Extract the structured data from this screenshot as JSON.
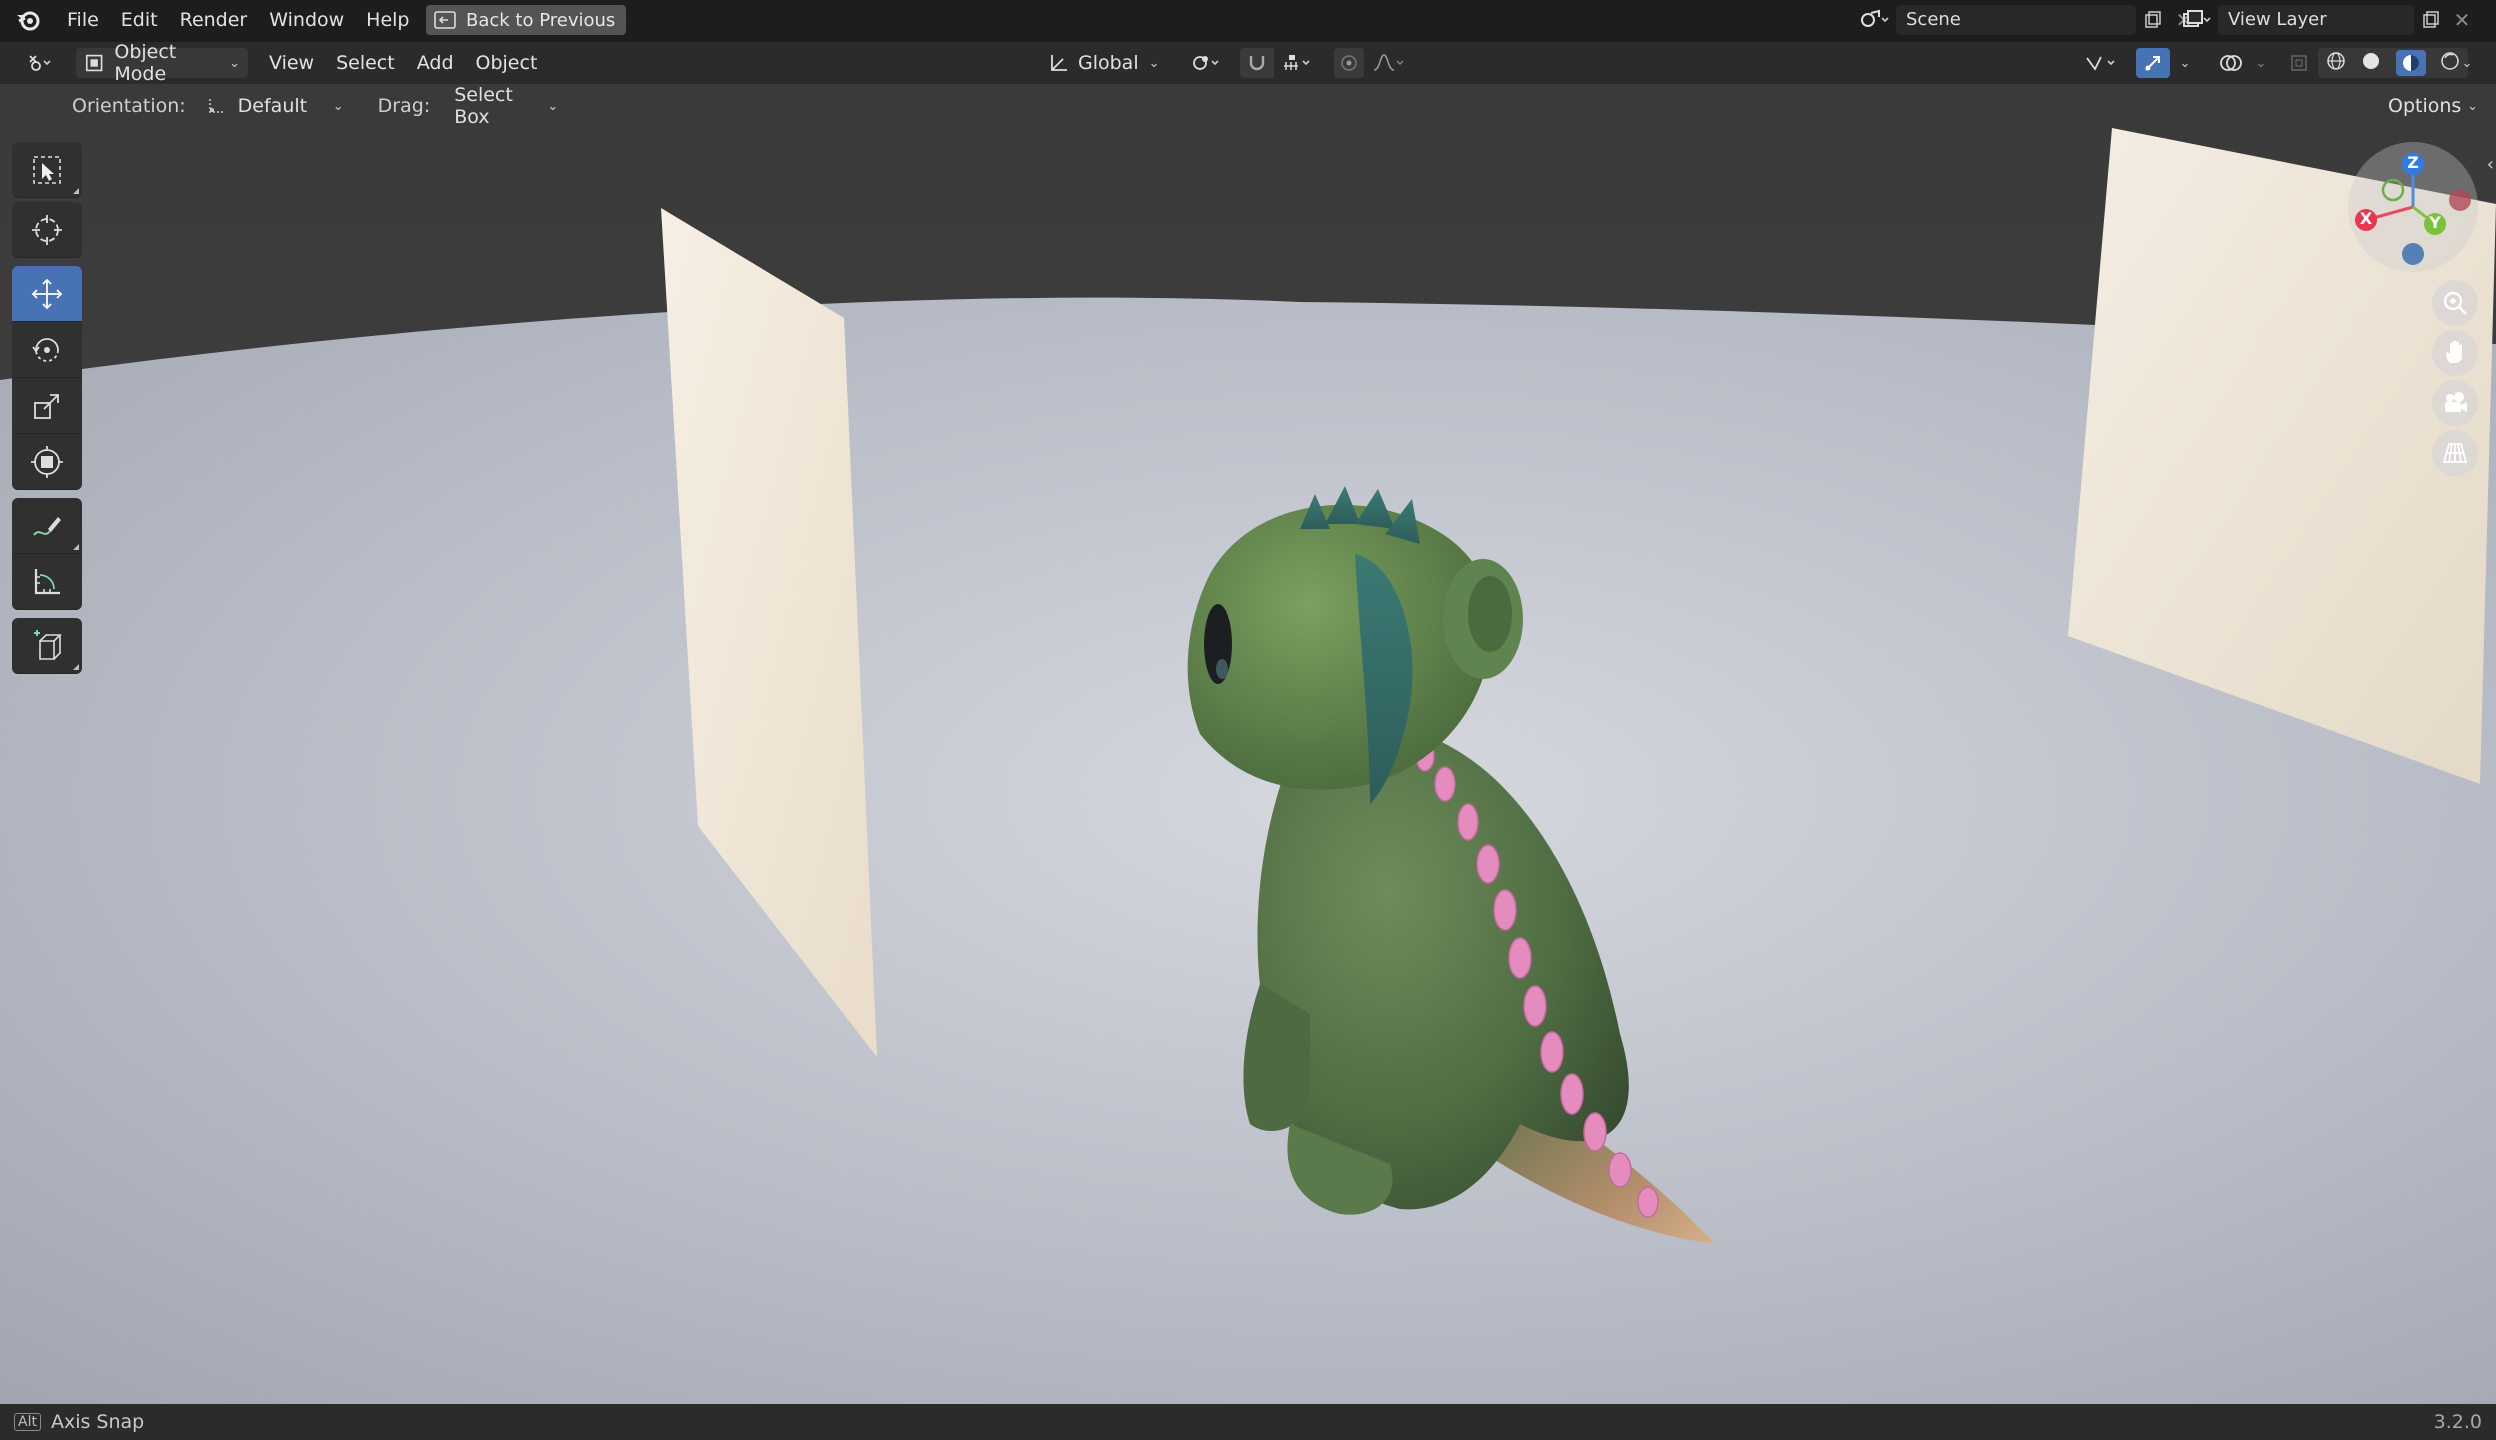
{
  "topbar": {
    "menu": [
      "File",
      "Edit",
      "Render",
      "Window",
      "Help"
    ],
    "back_button": "Back to Previous",
    "scene": "Scene",
    "view_layer": "View Layer"
  },
  "header": {
    "mode": "Object Mode",
    "menus": [
      "View",
      "Select",
      "Add",
      "Object"
    ],
    "transform_orientation": "Global"
  },
  "tool_settings": {
    "orientation_label": "Orientation:",
    "orientation_value": "Default",
    "drag_label": "Drag:",
    "drag_value": "Select Box",
    "options": "Options"
  },
  "toolbar": {
    "tools": [
      "select-box",
      "cursor",
      "move",
      "rotate",
      "scale",
      "transform",
      "annotate",
      "measure",
      "add-cube"
    ],
    "active": "move"
  },
  "gizmo": {
    "z": "Z",
    "x": "X",
    "y": "Y"
  },
  "statusbar": {
    "key": "Alt",
    "hint": "Axis Snap",
    "version": "3.2.0"
  }
}
